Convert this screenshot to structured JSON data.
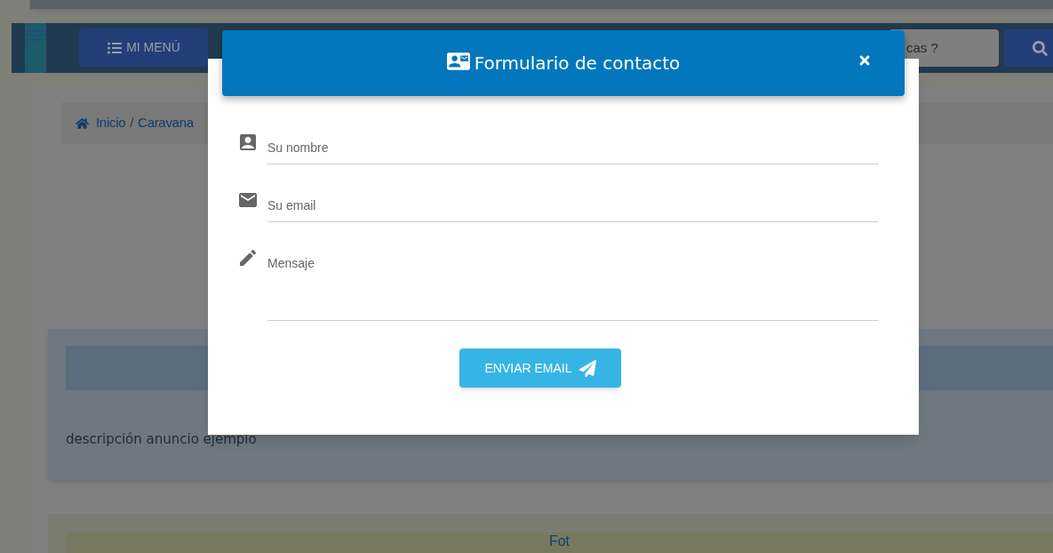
{
  "navbar": {
    "menu_button": "MI MENÚ",
    "search": {
      "placeholder": "cas ?"
    }
  },
  "breadcrumb": {
    "items": [
      "Inicio",
      "Caravana"
    ],
    "separator": "/"
  },
  "listing": {
    "description": "descripción anuncio ejemplo",
    "section_title": "Fot"
  },
  "modal": {
    "title": "Formulario de contacto",
    "fields": [
      {
        "kind": "name",
        "placeholder": "Su nombre"
      },
      {
        "kind": "email",
        "placeholder": "Su email"
      },
      {
        "kind": "message",
        "placeholder": "Mensaje"
      }
    ],
    "submit": "ENVIAR EMAIL"
  }
}
